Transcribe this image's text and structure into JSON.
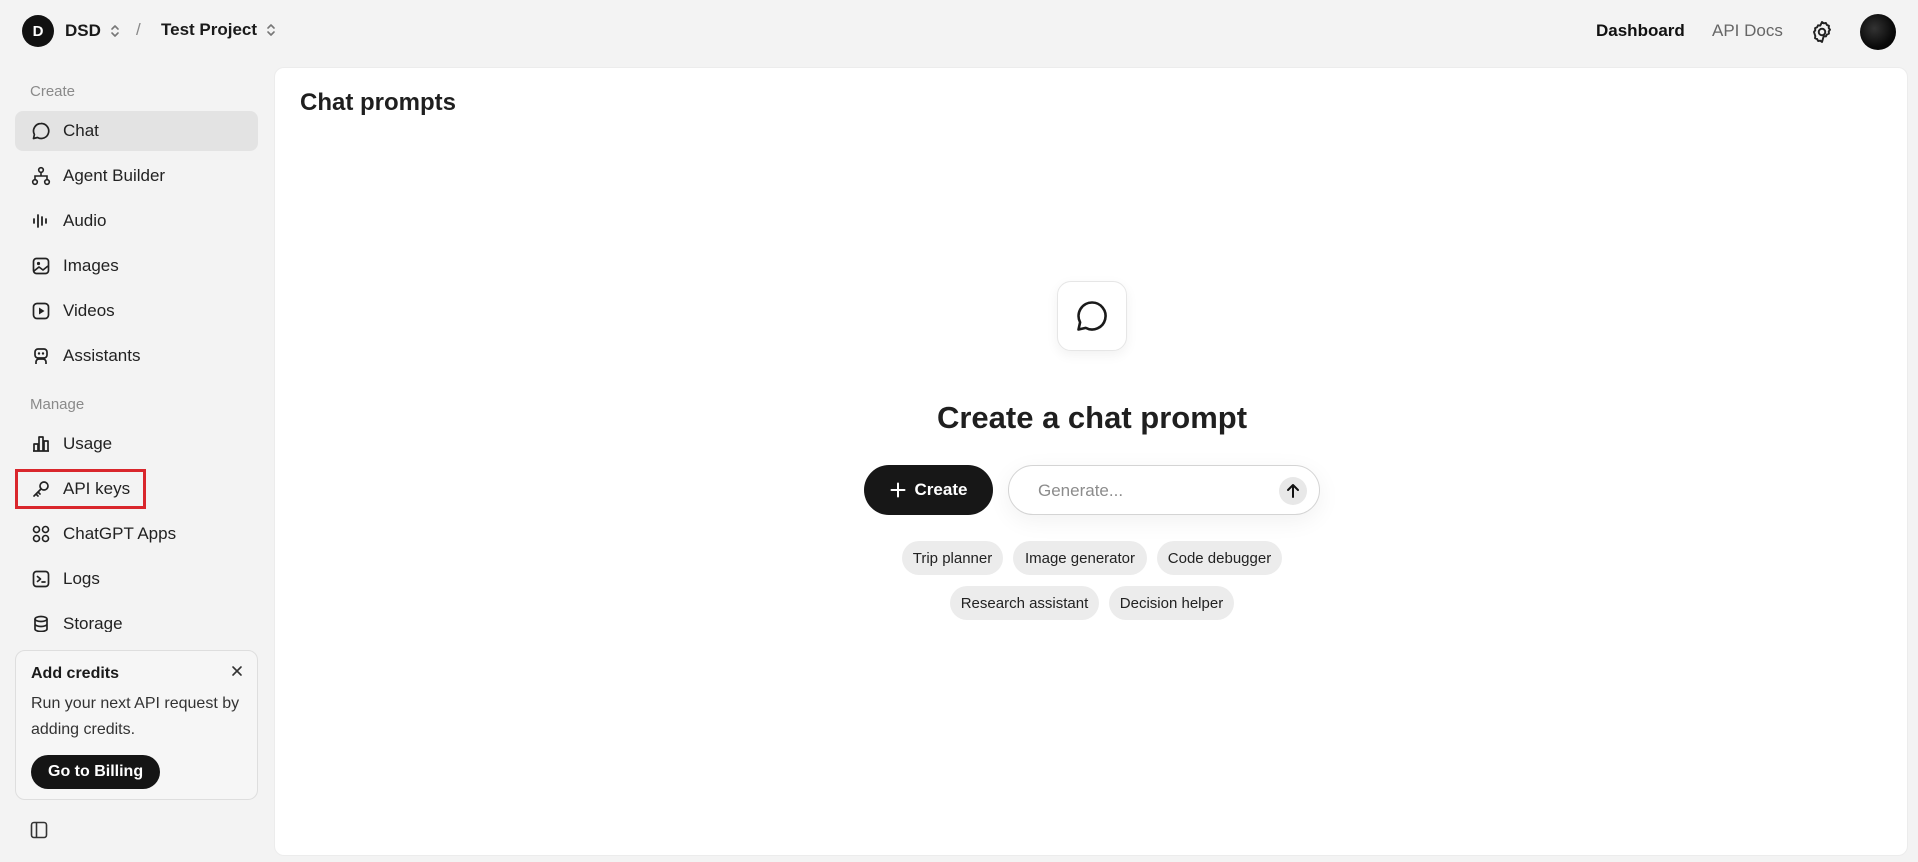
{
  "header": {
    "org_initial": "D",
    "org_name": "DSD",
    "separator": "/",
    "project_name": "Test Project",
    "nav": {
      "dashboard": "Dashboard",
      "api_docs": "API Docs"
    }
  },
  "sidebar": {
    "sections": [
      {
        "label": "Create",
        "items": [
          {
            "label": "Chat",
            "icon": "chat-bubble-icon",
            "active": true
          },
          {
            "label": "Agent Builder",
            "icon": "agent-nodes-icon"
          },
          {
            "label": "Audio",
            "icon": "audio-wave-icon"
          },
          {
            "label": "Images",
            "icon": "image-icon"
          },
          {
            "label": "Videos",
            "icon": "video-play-icon"
          },
          {
            "label": "Assistants",
            "icon": "robot-icon"
          }
        ]
      },
      {
        "label": "Manage",
        "items": [
          {
            "label": "Usage",
            "icon": "bar-chart-icon"
          },
          {
            "label": "API keys",
            "icon": "key-icon",
            "highlighted": true
          },
          {
            "label": "ChatGPT Apps",
            "icon": "apps-grid-icon"
          },
          {
            "label": "Logs",
            "icon": "terminal-icon"
          },
          {
            "label": "Storage",
            "icon": "database-icon"
          }
        ]
      }
    ],
    "credits": {
      "title": "Add credits",
      "text": "Run your next API request by adding credits.",
      "button": "Go to Billing"
    }
  },
  "main": {
    "title": "Chat prompts",
    "empty_state": {
      "heading": "Create a chat prompt",
      "create_label": "Create",
      "generate_placeholder": "Generate...",
      "suggestions": [
        "Trip planner",
        "Image generator",
        "Code debugger",
        "Research assistant",
        "Decision helper"
      ]
    }
  },
  "colors": {
    "accent": "#171717",
    "highlight_border": "#d9262c",
    "page_bg": "#f3f3f3",
    "active_item_bg": "#e3e3e3"
  }
}
